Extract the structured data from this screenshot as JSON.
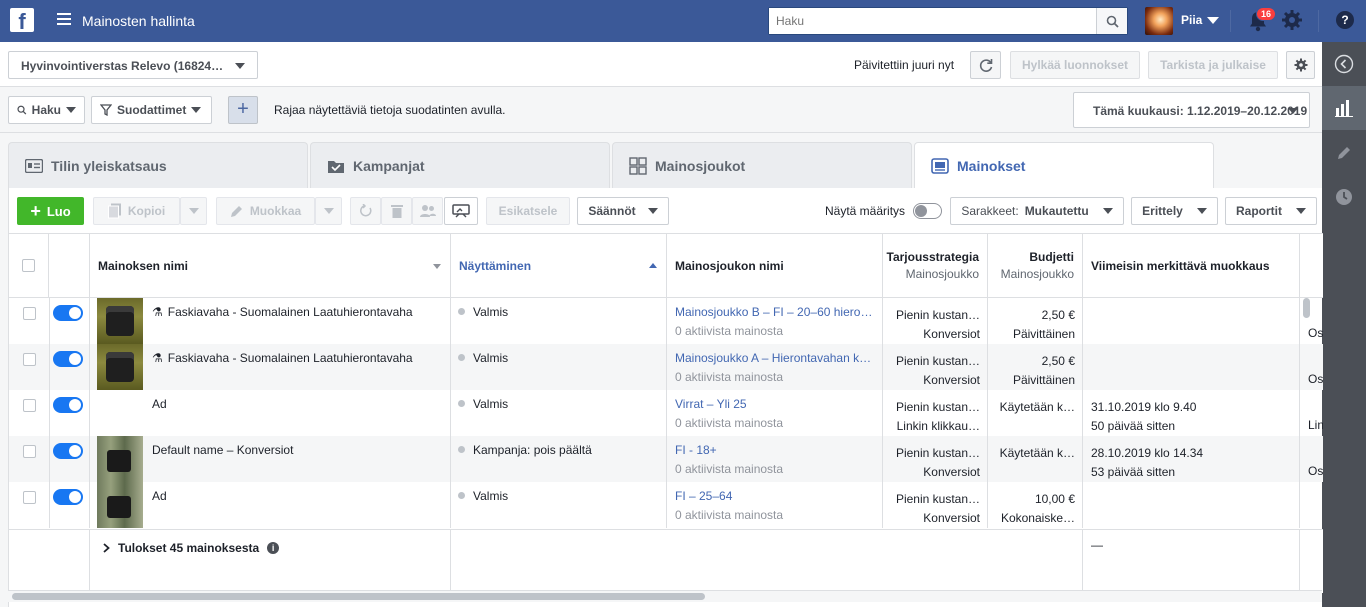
{
  "topbar": {
    "app_title": "Mainosten hallinta",
    "search_placeholder": "Haku",
    "user_name": "Piia",
    "notification_count": "16"
  },
  "account": {
    "selected": "Hyvinvointiverstas Relevo (16824…"
  },
  "header_actions": {
    "updated_text": "Päivitettiin juuri nyt",
    "discard_label": "Hylkää luonnokset",
    "review_label": "Tarkista ja julkaise"
  },
  "filters": {
    "search_label": "Haku",
    "filters_label": "Suodattimet",
    "hint": "Rajaa näytettäviä tietoja suodatinten avulla.",
    "date_range": "Tämä kuukausi: 1.12.2019–20.12.2019"
  },
  "tabs": [
    {
      "label": "Tilin yleiskatsaus"
    },
    {
      "label": "Kampanjat"
    },
    {
      "label": "Mainosjoukot"
    },
    {
      "label": "Mainokset"
    }
  ],
  "toolbar": {
    "create_label": "Luo",
    "copy_label": "Kopioi",
    "edit_label": "Muokkaa",
    "preview_label": "Esikatsele",
    "rules_label": "Säännöt",
    "show_spec_label": "Näytä määritys",
    "columns_label": "Sarakkeet:",
    "columns_value": "Mukautettu",
    "breakdown_label": "Erittely",
    "reports_label": "Raportit"
  },
  "columns": {
    "ad_name": "Mainoksen nimi",
    "delivery": "Näyttäminen",
    "adset_name": "Mainosjoukon nimi",
    "bid_strategy": "Tarjousstrategia",
    "bid_strategy_sub": "Mainosjoukko",
    "budget": "Budjetti",
    "budget_sub": "Mainosjoukko",
    "last_edit": "Viimeisin merkittävä muokkaus"
  },
  "rows": [
    {
      "thumb": "jar",
      "test_icon": "⚗",
      "name": "Faskiavaha - Suomalainen Laatuhierontavaha",
      "status": "Valmis",
      "adset": "Mainosjoukko B – FI – 20–60 hiero…",
      "adset_sub": "0 aktiivista mainosta",
      "bid": "Pienin kustan…",
      "bid_sub": "Konversiot",
      "budget": "2,50 €",
      "budget_sub": "Päivittäinen",
      "edit": "",
      "edit_sub": "",
      "extra": "Os"
    },
    {
      "thumb": "jar",
      "test_icon": "⚗",
      "name": "Faskiavaha - Suomalainen Laatuhierontavaha",
      "status": "Valmis",
      "adset": "Mainosjoukko A – Hierontavahan k…",
      "adset_sub": "0 aktiivista mainosta",
      "bid": "Pienin kustan…",
      "bid_sub": "Konversiot",
      "budget": "2,50 €",
      "budget_sub": "Päivittäinen",
      "edit": "",
      "edit_sub": "",
      "extra": "Os"
    },
    {
      "thumb": "none",
      "test_icon": "",
      "name": "Ad",
      "status": "Valmis",
      "adset": "Virrat – Yli 25",
      "adset_sub": "0 aktiivista mainosta",
      "bid": "Pienin kustan…",
      "bid_sub": "Linkin klikkau…",
      "budget": "Käytetään k…",
      "budget_sub": "",
      "edit": "31.10.2019 klo 9.40",
      "edit_sub": "50 päivää sitten",
      "extra": "Lin"
    },
    {
      "thumb": "forest",
      "test_icon": "",
      "name": "Default name – Konversiot",
      "status": "Kampanja: pois päältä",
      "adset": "FI - 18+",
      "adset_sub": "0 aktiivista mainosta",
      "bid": "Pienin kustan…",
      "bid_sub": "Konversiot",
      "budget": "Käytetään k…",
      "budget_sub": "",
      "edit": "28.10.2019 klo 14.34",
      "edit_sub": "53 päivää sitten",
      "extra": "Os"
    },
    {
      "thumb": "forest",
      "test_icon": "",
      "name": "Ad",
      "status": "Valmis",
      "adset": "FI – 25–64",
      "adset_sub": "0 aktiivista mainosta",
      "bid": "Pienin kustan…",
      "bid_sub": "Konversiot",
      "budget": "10,00 €",
      "budget_sub": "Kokonaiske…",
      "edit": "",
      "edit_sub": "",
      "extra": ""
    }
  ],
  "footer": {
    "results_label": "Tulokset 45 mainoksesta",
    "dash": "—"
  },
  "colors": {
    "brand": "#3b5998",
    "accent": "#4267b2",
    "create": "#42b72a",
    "toggle_on": "#1877f2"
  }
}
